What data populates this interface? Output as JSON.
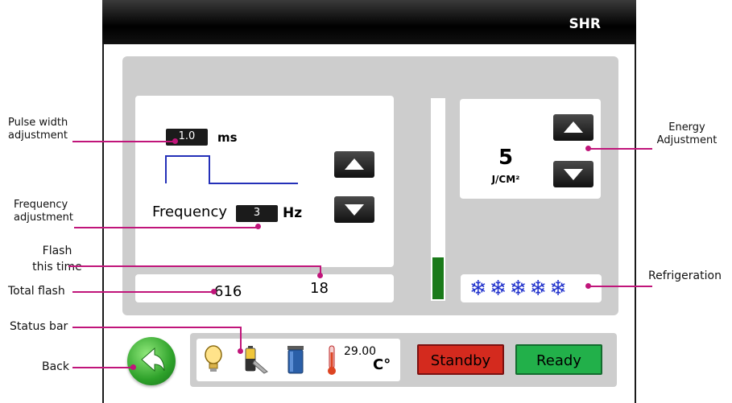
{
  "window": {
    "title": "SHR"
  },
  "pulse": {
    "value": "1.0",
    "unit": "ms"
  },
  "frequency": {
    "label": "Frequency",
    "value": "3",
    "unit": "Hz"
  },
  "energy": {
    "value": "5",
    "unit": "J/CM²"
  },
  "counters": {
    "total_flash": "616",
    "flash_this_time": "18"
  },
  "energy_level_bar": {
    "fill_fraction": 0.21,
    "color": "#1a7a1a"
  },
  "status": {
    "temperature": "29.00",
    "temperature_unit": "C°",
    "icons": [
      "lightbulb-icon",
      "battery-icon",
      "water-tank-icon",
      "thermometer-icon"
    ],
    "standby_label": "Standby",
    "ready_label": "Ready",
    "standby_color": "#d42a1e",
    "ready_color": "#22b04a"
  },
  "refrigeration": {
    "level_count": 5,
    "icon": "snowflake-icon"
  },
  "callouts": {
    "pulse_width": "Pulse width adjustment",
    "frequency": "Frequency adjustment",
    "flash_this_time": "Flash this time",
    "total_flash": "Total flash",
    "status_bar": "Status bar",
    "back": "Back",
    "energy": "Energy Adjustment",
    "refrigeration": "Refrigeration"
  }
}
